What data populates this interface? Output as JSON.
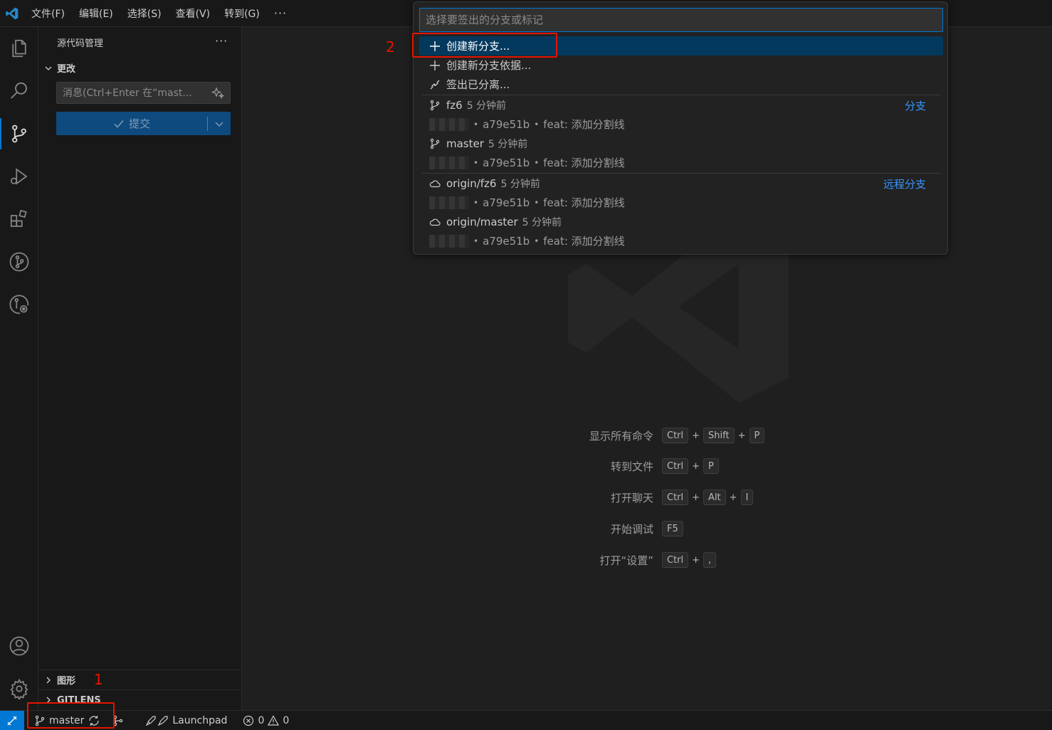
{
  "menu": {
    "items": [
      "文件(F)",
      "编辑(E)",
      "选择(S)",
      "查看(V)",
      "转到(G)"
    ],
    "more": "···"
  },
  "sidebar": {
    "title": "源代码管理",
    "more": "···",
    "changes_label": "更改",
    "message_placeholder": "消息(Ctrl+Enter 在“mast...",
    "commit_label": "提交",
    "graph_label": "图形",
    "gitlens_label": "GITLENS"
  },
  "annotations": {
    "one": "1",
    "two": "2"
  },
  "quickpick": {
    "placeholder": "选择要签出的分支或标记",
    "actions": [
      "创建新分支...",
      "创建新分支依据...",
      "签出已分离..."
    ],
    "branch_group_label": "分支",
    "remote_group_label": "远程分支",
    "branches": [
      {
        "name": "fz6",
        "time": "5 分钟前",
        "hash": "a79e51b",
        "message": "feat: 添加分割线"
      },
      {
        "name": "master",
        "time": "5 分钟前",
        "hash": "a79e51b",
        "message": "feat: 添加分割线"
      }
    ],
    "remotes": [
      {
        "name": "origin/fz6",
        "time": "5 分钟前",
        "hash": "a79e51b",
        "message": "feat: 添加分割线"
      },
      {
        "name": "origin/master",
        "time": "5 分钟前",
        "hash": "a79e51b",
        "message": "feat: 添加分割线"
      }
    ],
    "bullet": "•"
  },
  "shortcuts": [
    {
      "label": "显示所有命令",
      "keys": [
        "Ctrl",
        "Shift",
        "P"
      ]
    },
    {
      "label": "转到文件",
      "keys": [
        "Ctrl",
        "P"
      ]
    },
    {
      "label": "打开聊天",
      "keys": [
        "Ctrl",
        "Alt",
        "I"
      ]
    },
    {
      "label": "开始调试",
      "keys": [
        "F5"
      ]
    },
    {
      "label": "打开“设置”",
      "keys": [
        "Ctrl",
        ","
      ]
    }
  ],
  "statusbar": {
    "branch": "master",
    "launchpad": "Launchpad",
    "errors": "0",
    "warnings": "0"
  },
  "colors": {
    "accent": "#0078d4",
    "selected_row": "#04395e",
    "annotation_red": "#e51400",
    "link_blue": "#3794ff"
  }
}
